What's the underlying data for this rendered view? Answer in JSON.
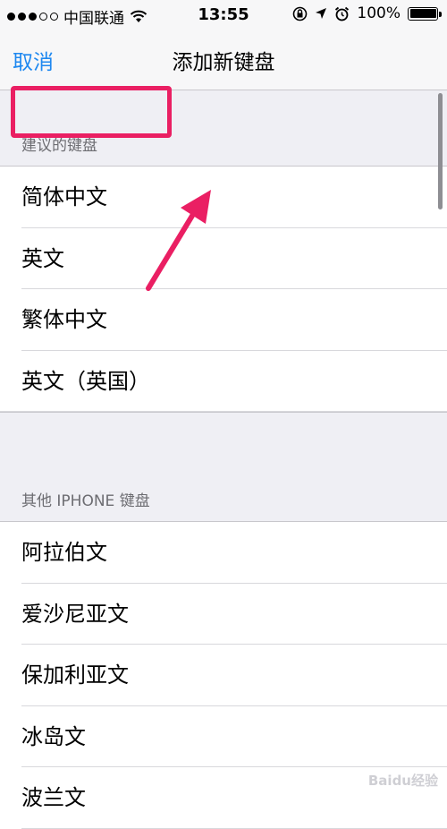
{
  "status_bar": {
    "carrier": "中国联通",
    "time": "13:55",
    "battery": "100%",
    "battery_level": 1.0,
    "signal": {
      "filled": 3,
      "total": 5
    },
    "icons": [
      "wifi-icon",
      "rotation-lock-icon",
      "location-icon",
      "alarm-icon",
      "battery-icon"
    ]
  },
  "nav": {
    "cancel": "取消",
    "title": "添加新键盘"
  },
  "sections": [
    {
      "header": "建议的键盘",
      "items": [
        "简体中文",
        "英文",
        "繁体中文",
        "英文（英国）"
      ]
    },
    {
      "header": "其他 IPHONE 键盘",
      "items": [
        "阿拉伯文",
        "爱沙尼亚文",
        "保加利亚文",
        "冰岛文",
        "波兰文"
      ]
    }
  ],
  "annotation": {
    "highlight_color": "#ea1f63",
    "highlighted_item": "简体中文"
  },
  "colors": {
    "accent": "#1e88f0",
    "background": "#efeff4"
  },
  "watermark": "Baidu经验"
}
